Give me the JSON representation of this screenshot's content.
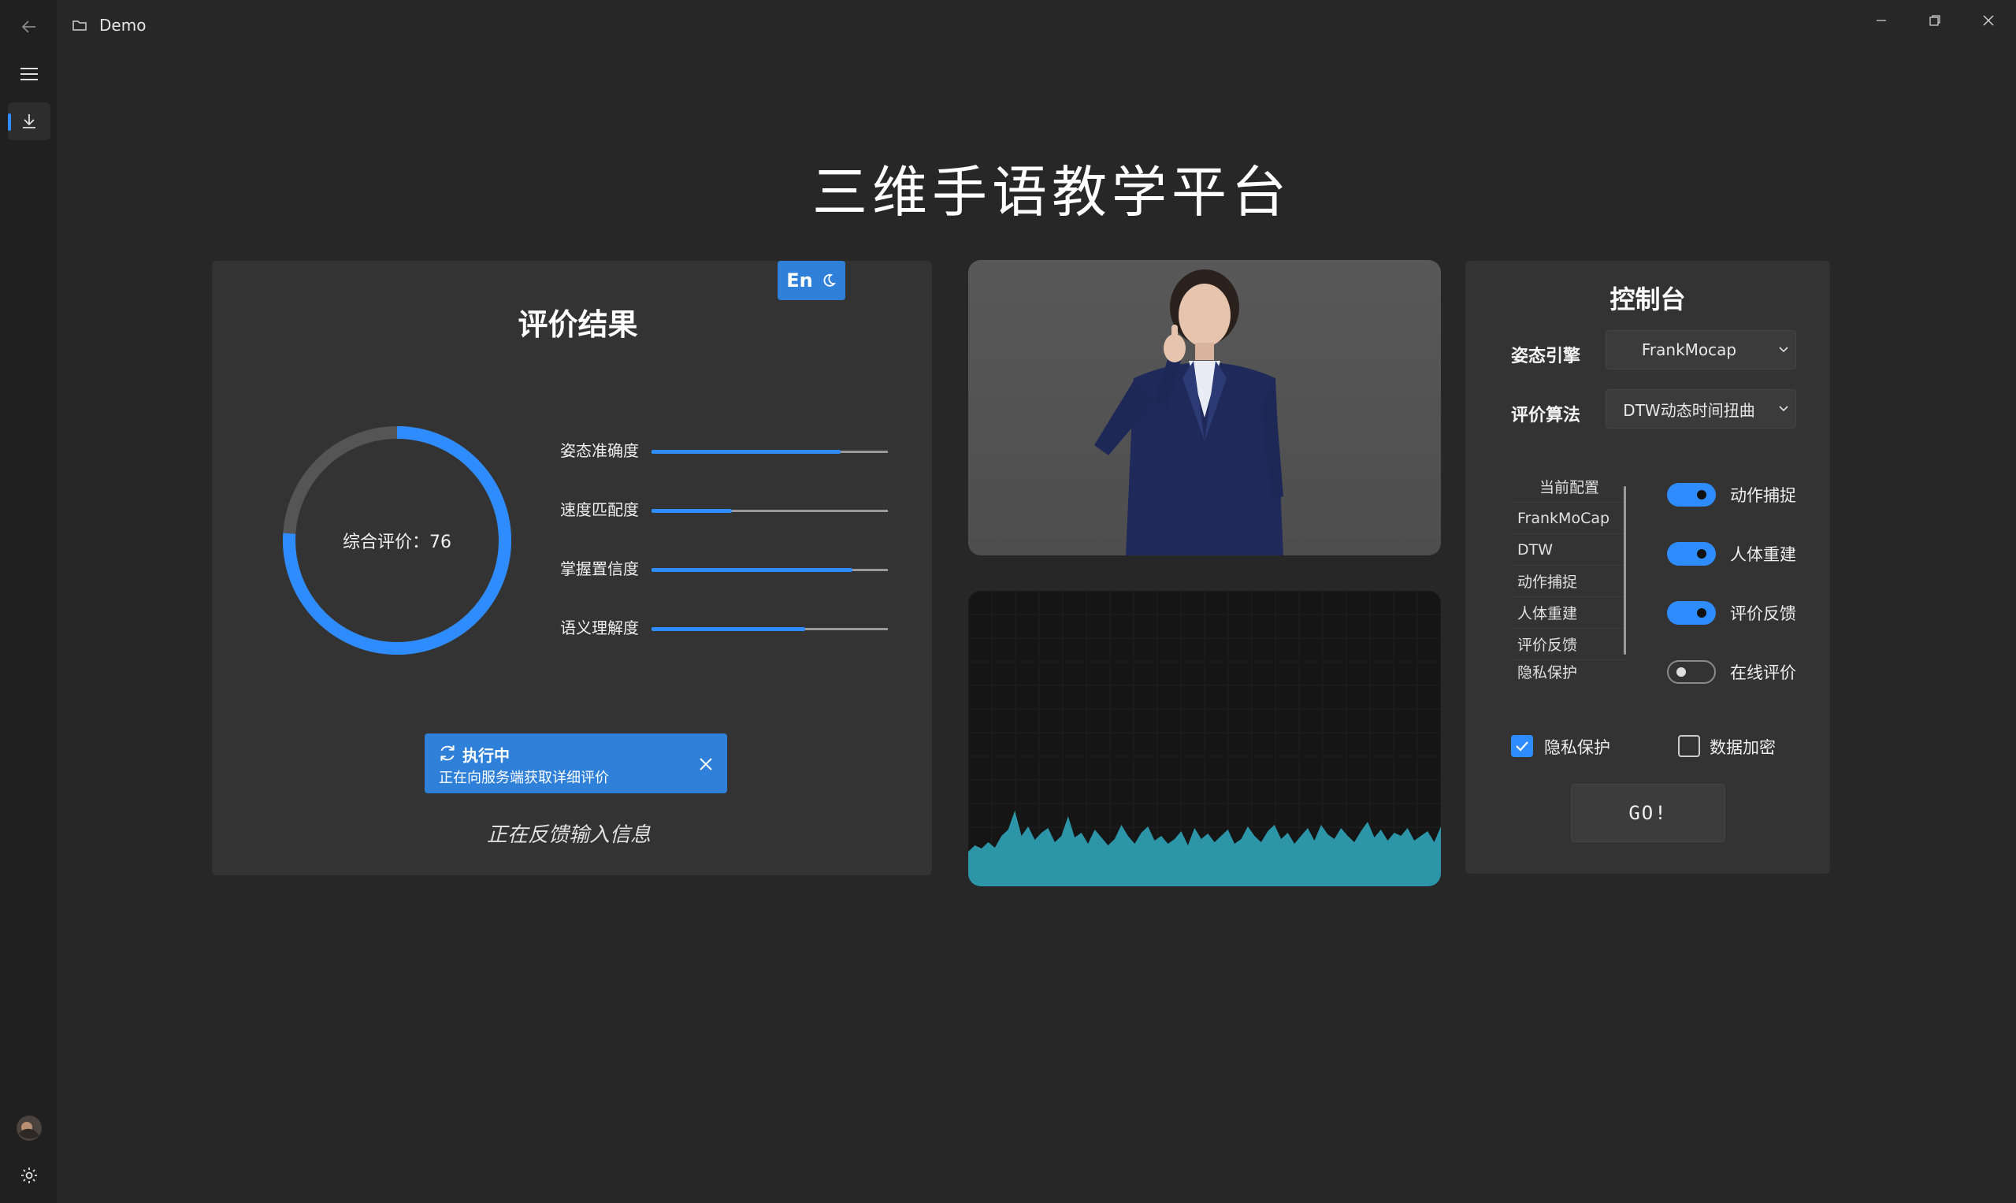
{
  "window": {
    "title": "Demo"
  },
  "page_title": "三维手语教学平台",
  "evaluation": {
    "title": "评价结果",
    "lang_button": "En",
    "overall_label": "综合评价：76",
    "overall_score": 76,
    "metrics": [
      {
        "label": "姿态准确度",
        "value": 0.8
      },
      {
        "label": "速度匹配度",
        "value": 0.34
      },
      {
        "label": "掌握置信度",
        "value": 0.85
      },
      {
        "label": "语义理解度",
        "value": 0.65
      }
    ],
    "toast": {
      "title": "执行中",
      "message": "正在向服务端获取详细评价"
    },
    "feedback": "正在反馈输入信息"
  },
  "control": {
    "title": "控制台",
    "engine_label": "姿态引擎",
    "engine_value": "FrankMocap",
    "algorithm_label": "评价算法",
    "algorithm_value": "DTW动态时间扭曲",
    "config_list": [
      "当前配置",
      "FrankMoCap",
      "DTW",
      "动作捕捉",
      "人体重建",
      "评价反馈",
      "隐私保护"
    ],
    "toggles": [
      {
        "label": "动作捕捉",
        "on": true
      },
      {
        "label": "人体重建",
        "on": true
      },
      {
        "label": "评价反馈",
        "on": true
      },
      {
        "label": "在线评价",
        "on": false
      }
    ],
    "checkboxes": [
      {
        "label": "隐私保护",
        "checked": true
      },
      {
        "label": "数据加密",
        "checked": false
      }
    ],
    "go_button": "GO!"
  },
  "colors": {
    "accent": "#2f8cff",
    "wave": "#2d95a8",
    "panel": "#333333",
    "background": "#272727"
  },
  "waveform": [
    0.1,
    0.18,
    0.14,
    0.22,
    0.15,
    0.3,
    0.38,
    0.62,
    0.3,
    0.42,
    0.25,
    0.34,
    0.4,
    0.22,
    0.3,
    0.55,
    0.28,
    0.34,
    0.2,
    0.38,
    0.28,
    0.18,
    0.26,
    0.44,
    0.3,
    0.2,
    0.34,
    0.42,
    0.24,
    0.3,
    0.2,
    0.26,
    0.36,
    0.18,
    0.4,
    0.26,
    0.33,
    0.22,
    0.3,
    0.38,
    0.2,
    0.26,
    0.42,
    0.3,
    0.22,
    0.36,
    0.44,
    0.26,
    0.34,
    0.2,
    0.3,
    0.4,
    0.24,
    0.44,
    0.32,
    0.26,
    0.4,
    0.3,
    0.22,
    0.36,
    0.48,
    0.28,
    0.38,
    0.24,
    0.34,
    0.3,
    0.4,
    0.24,
    0.3,
    0.36,
    0.22,
    0.42
  ]
}
